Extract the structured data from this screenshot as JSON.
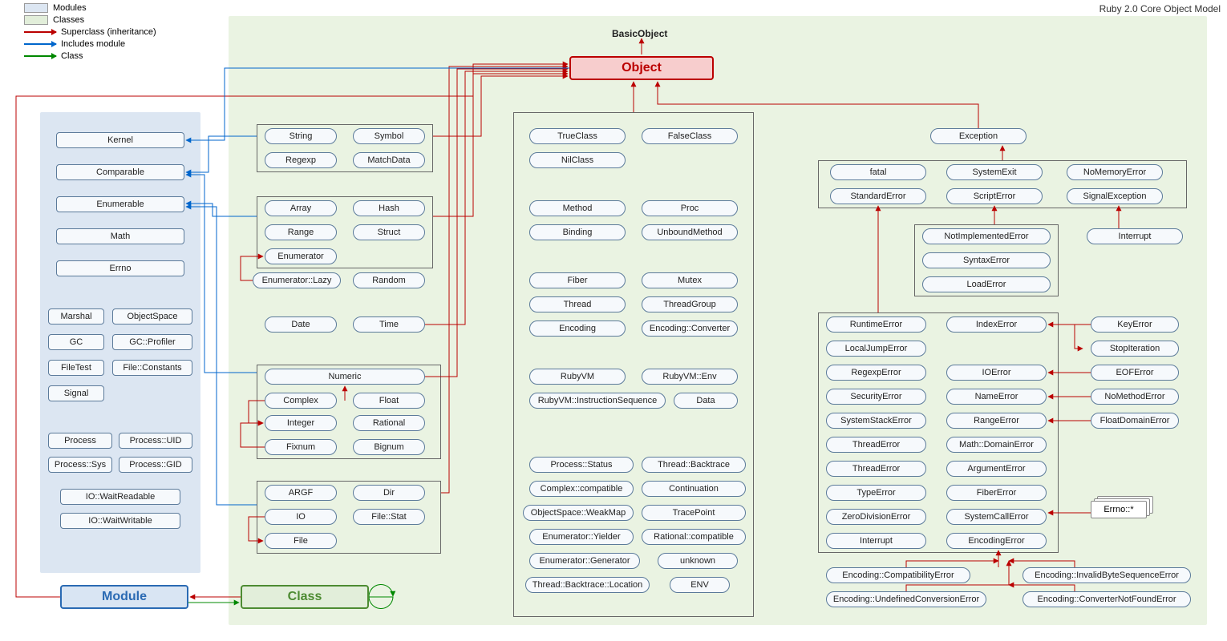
{
  "title": "Ruby 2.0 Core Object Model",
  "legend": {
    "modules": "Modules",
    "classes": "Classes",
    "superclass": "Superclass (inheritance)",
    "includes": "Includes module",
    "class": "Class"
  },
  "top": {
    "basicObject": "BasicObject",
    "object": "Object"
  },
  "modules": {
    "kernel": "Kernel",
    "comparable": "Comparable",
    "enumerable": "Enumerable",
    "math": "Math",
    "errno": "Errno",
    "marshal": "Marshal",
    "objectSpace": "ObjectSpace",
    "gc": "GC",
    "gcProfiler": "GC::Profiler",
    "fileTest": "FileTest",
    "fileConstants": "File::Constants",
    "signal": "Signal",
    "process": "Process",
    "processUid": "Process::UID",
    "processSys": "Process::Sys",
    "processGid": "Process::GID",
    "ioWaitR": "IO::WaitReadable",
    "ioWaitW": "IO::WaitWritable"
  },
  "col2": {
    "string": "String",
    "symbol": "Symbol",
    "regexp": "Regexp",
    "matchData": "MatchData",
    "array": "Array",
    "hash": "Hash",
    "range": "Range",
    "struct": "Struct",
    "enumerator": "Enumerator",
    "enumLazy": "Enumerator::Lazy",
    "random": "Random",
    "date": "Date",
    "time": "Time",
    "numeric": "Numeric",
    "complex": "Complex",
    "float": "Float",
    "integer": "Integer",
    "rational": "Rational",
    "fixnum": "Fixnum",
    "bignum": "Bignum",
    "argf": "ARGF",
    "dir": "Dir",
    "io": "IO",
    "fileStat": "File::Stat",
    "file": "File"
  },
  "col3": {
    "trueClass": "TrueClass",
    "falseClass": "FalseClass",
    "nilClass": "NilClass",
    "method": "Method",
    "proc": "Proc",
    "binding": "Binding",
    "unboundMethod": "UnboundMethod",
    "fiber": "Fiber",
    "mutex": "Mutex",
    "thread": "Thread",
    "threadGroup": "ThreadGroup",
    "encoding": "Encoding",
    "encConverter": "Encoding::Converter",
    "rubyVm": "RubyVM",
    "rubyVmEnv": "RubyVM::Env",
    "rubyVmIs": "RubyVM::InstructionSequence",
    "data": "Data",
    "processStatus": "Process::Status",
    "threadBacktrace": "Thread::Backtrace",
    "complexCompat": "Complex::compatible",
    "continuation": "Continuation",
    "osWeakMap": "ObjectSpace::WeakMap",
    "tracePoint": "TracePoint",
    "enumYielder": "Enumerator::Yielder",
    "rationalCompat": "Rational::compatible",
    "enumGenerator": "Enumerator::Generator",
    "unknown": "unknown",
    "threadBtLoc": "Thread::Backtrace::Location",
    "env": "ENV"
  },
  "exceptions": {
    "exception": "Exception",
    "fatal": "fatal",
    "systemExit": "SystemExit",
    "noMemoryError": "NoMemoryError",
    "standardError": "StandardError",
    "scriptError": "ScriptError",
    "signalException": "SignalException",
    "notImplementedError": "NotImplementedError",
    "syntaxError": "SyntaxError",
    "loadError": "LoadError",
    "interrupt": "Interrupt",
    "runtimeError": "RuntimeError",
    "indexError": "IndexError",
    "keyError": "KeyError",
    "stopIteration": "StopIteration",
    "localJumpError": "LocalJumpError",
    "regexpError": "RegexpError",
    "ioError": "IOError",
    "eofError": "EOFError",
    "securityError": "SecurityError",
    "nameError": "NameError",
    "noMethodError": "NoMethodError",
    "systemStackError": "SystemStackError",
    "rangeError": "RangeError",
    "floatDomainError": "FloatDomainError",
    "threadError": "ThreadError",
    "mathDomainError": "Math::DomainError",
    "threadError2": "ThreadError",
    "argumentError": "ArgumentError",
    "typeError": "TypeError",
    "fiberError": "FiberError",
    "zeroDivisionError": "ZeroDivisionError",
    "systemCallError": "SystemCallError",
    "interrupt2": "Interrupt",
    "encodingError": "EncodingError",
    "errnoStar": "Errno::*",
    "encCompat": "Encoding::CompatibilityError",
    "encInvalid": "Encoding::InvalidByteSequenceError",
    "encUndef": "Encoding::UndefinedConversionError",
    "encConvNotFound": "Encoding::ConverterNotFoundError"
  },
  "bottom": {
    "module": "Module",
    "class": "Class"
  }
}
